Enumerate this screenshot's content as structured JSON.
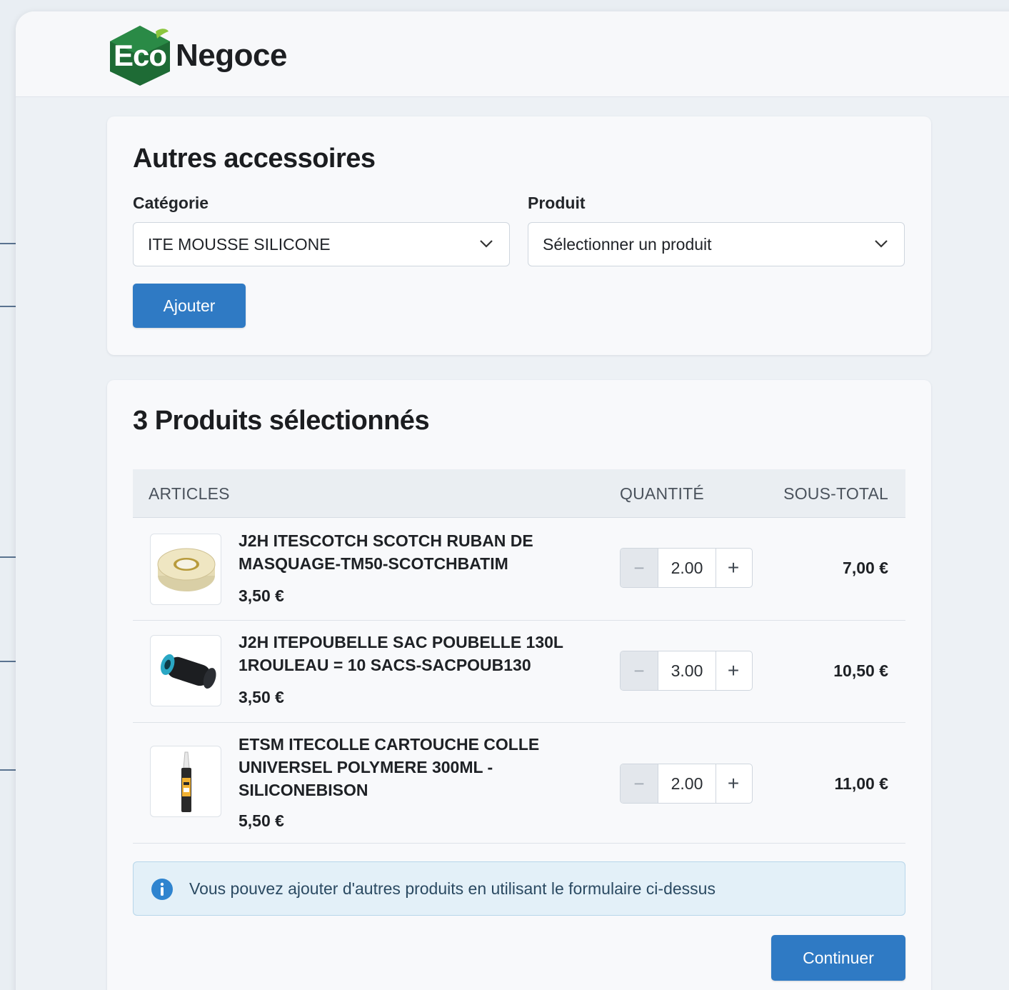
{
  "app": {
    "logo_eco": "Eco",
    "logo_negoce": "Negoce"
  },
  "accessories": {
    "title": "Autres accessoires",
    "category_label": "Catégorie",
    "category_value": "ITE MOUSSE SILICONE",
    "product_label": "Produit",
    "product_placeholder": "Sélectionner un produit",
    "add_button": "Ajouter"
  },
  "selection": {
    "title": "3 Produits sélectionnés",
    "columns": {
      "articles": "ARTICLES",
      "quantity": "QUANTITÉ",
      "subtotal": "SOUS-TOTAL"
    },
    "items": [
      {
        "name": "J2H ITESCOTCH SCOTCH RUBAN DE MASQUAGE-TM50-SCOTCHBATIM",
        "unit_price": "3,50 €",
        "quantity": "2.00",
        "subtotal": "7,00 €",
        "icon": "tape-roll-icon"
      },
      {
        "name": "J2H ITEPOUBELLE SAC POUBELLE 130L 1ROULEAU = 10 SACS-SACPOUB130",
        "unit_price": "3,50 €",
        "quantity": "3.00",
        "subtotal": "10,50 €",
        "icon": "trash-bag-roll-icon"
      },
      {
        "name": "ETSM ITECOLLE CARTOUCHE COLLE UNIVERSEL POLYMERE 300ML - SILICONEBISON",
        "unit_price": "5,50 €",
        "quantity": "2.00",
        "subtotal": "11,00 €",
        "icon": "glue-cartridge-icon"
      }
    ],
    "stepper": {
      "minus": "−",
      "plus": "+"
    },
    "info_message": "Vous pouvez ajouter d'autres produits en utilisant le formulaire ci-dessus",
    "continue_button": "Continuer"
  },
  "colors": {
    "primary": "#2f7ac4",
    "logo_green": "#1e6b35",
    "info_bg": "#e3f0f8",
    "info_icon": "#2f84cf"
  }
}
